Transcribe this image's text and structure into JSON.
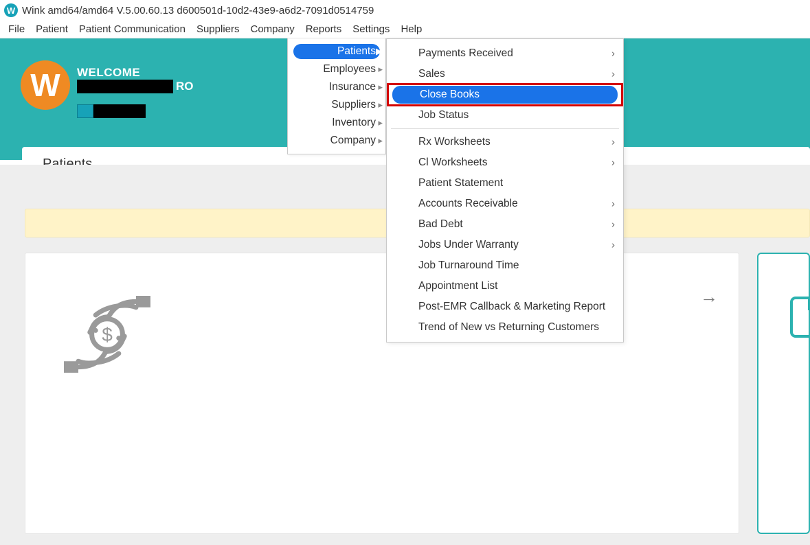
{
  "title": "Wink amd64/amd64 V.5.00.60.13 d600501d-10d2-43e9-a6d2-7091d0514759",
  "menubar": {
    "file": "File",
    "patient": "Patient",
    "patient_comm": "Patient Communication",
    "suppliers": "Suppliers",
    "company": "Company",
    "reports": "Reports",
    "settings": "Settings",
    "help": "Help"
  },
  "welcome": "WELCOME",
  "ro": "RO",
  "patients_tab": "Patients",
  "reports_menu": {
    "patients": "Patients",
    "employees": "Employees",
    "insurance": "Insurance",
    "suppliers": "Suppliers",
    "inventory": "Inventory",
    "company": "Company"
  },
  "patients_submenu": {
    "payments_received": "Payments Received",
    "sales": "Sales",
    "close_books": "Close Books",
    "job_status": "Job Status",
    "rx_worksheets": "Rx Worksheets",
    "cl_worksheets": "Cl Worksheets",
    "patient_statement": "Patient Statement",
    "accounts_receivable": "Accounts Receivable",
    "bad_debt": "Bad Debt",
    "jobs_under_warranty": "Jobs Under Warranty",
    "job_turnaround_time": "Job Turnaround Time",
    "appointment_list": "Appointment List",
    "post_emr": "Post-EMR Callback & Marketing Report",
    "trend_new_returning": "Trend of New vs Returning Customers"
  },
  "icons": {
    "logo_letter": "W",
    "title_icon_letter": "W",
    "arrow_right": "→"
  }
}
